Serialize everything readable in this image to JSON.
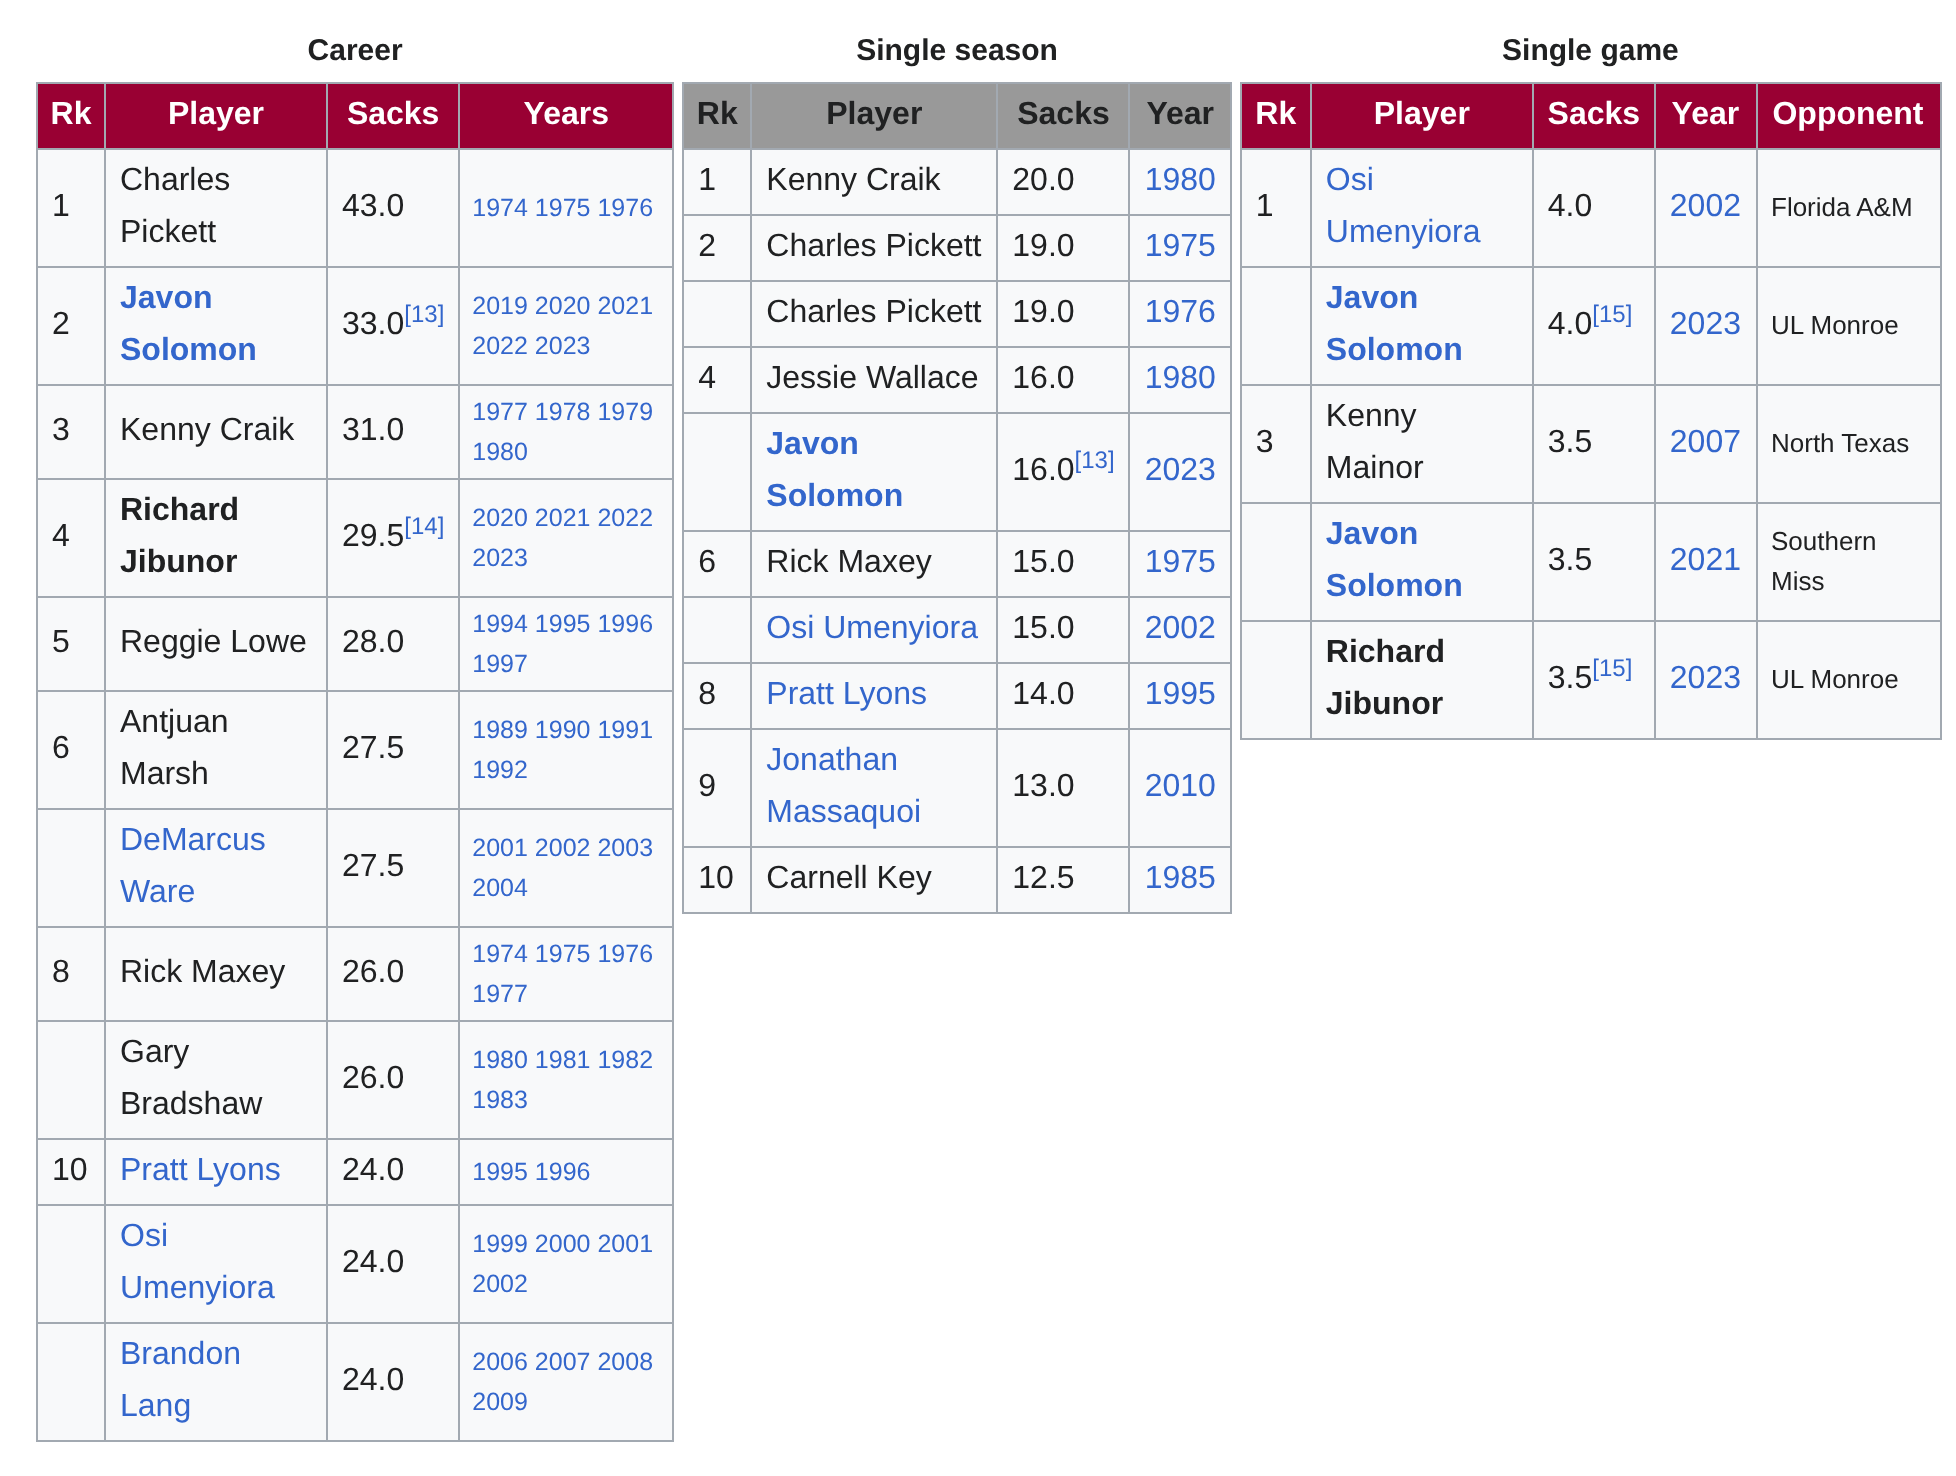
{
  "tables": [
    {
      "title": "Career",
      "color": "#990033",
      "columns": [
        {
          "label": "Rk",
          "kind": "rank"
        },
        {
          "label": "Player",
          "kind": "player"
        },
        {
          "label": "Sacks",
          "kind": "sacks"
        },
        {
          "label": "Years",
          "kind": "years"
        }
      ],
      "rows": [
        {
          "rank": "1",
          "player": "Charles Pickett",
          "link": false,
          "bold": false,
          "sacks": "43.0",
          "years": "1974 1975 1976"
        },
        {
          "rank": "2",
          "player": "Javon Solomon",
          "link": true,
          "bold": true,
          "sacks": "33.0$^{[13]}$",
          "years": "2019 2020 2021 2022 2023"
        },
        {
          "rank": "3",
          "player": "Kenny Craik",
          "link": false,
          "bold": false,
          "sacks": "31.0",
          "years": "1977 1978 1979 1980"
        },
        {
          "rank": "4",
          "player": "Richard Jibunor",
          "link": false,
          "bold": true,
          "sacks": "29.5$^{[14]}$",
          "years": "2020 2021 2022 2023"
        },
        {
          "rank": "5",
          "player": "Reggie Lowe",
          "link": false,
          "bold": false,
          "sacks": "28.0",
          "years": "1994 1995 1996 1997"
        },
        {
          "rank": "6",
          "player": "Antjuan Marsh",
          "link": false,
          "bold": false,
          "sacks": "27.5",
          "years": "1989 1990 1991 1992"
        },
        {
          "player": "DeMarcus Ware",
          "link": true,
          "bold": false,
          "sacks": "27.5",
          "years": "2001 2002 2003 2004"
        },
        {
          "rank": "8",
          "player": "Rick Maxey",
          "link": false,
          "bold": false,
          "sacks": "26.0",
          "years": "1974 1975 1976 1977"
        },
        {
          "player": "Gary Bradshaw",
          "link": false,
          "bold": false,
          "sacks": "26.0",
          "years": "1980 1981 1982 1983"
        },
        {
          "rank": "10",
          "player": "Pratt Lyons",
          "link": true,
          "bold": false,
          "sacks": "24.0",
          "years": "1995 1996"
        },
        {
          "player": "Osi Umenyiora",
          "link": true,
          "bold": false,
          "sacks": "24.0",
          "years": "1999 2000 2001 2002"
        },
        {
          "player": "Brandon Lang",
          "link": true,
          "bold": false,
          "sacks": "24.0",
          "years": "2006 2007 2008 2009"
        }
      ]
    },
    {
      "title": "Single season",
      "color": "#999999",
      "columns": [
        {
          "label": "Rk",
          "kind": "rank"
        },
        {
          "label": "Player",
          "kind": "player"
        },
        {
          "label": "Sacks",
          "kind": "sacks"
        },
        {
          "label": "Year",
          "kind": "year"
        }
      ],
      "rows": [
        {
          "rank": "1",
          "player": "Kenny Craik",
          "link": false,
          "bold": false,
          "sacks": "20.0",
          "year": "1980"
        },
        {
          "rank": "2",
          "player": "Charles Pickett",
          "link": false,
          "bold": false,
          "sacks": "19.0",
          "year": "1975"
        },
        {
          "player": "Charles Pickett",
          "link": false,
          "bold": false,
          "sacks": "19.0",
          "year": "1976"
        },
        {
          "rank": "4",
          "player": "Jessie Wallace",
          "link": false,
          "bold": false,
          "sacks": "16.0",
          "year": "1980"
        },
        {
          "player": "Javon Solomon",
          "link": true,
          "bold": true,
          "sacks": "16.0$^{[13]}$",
          "year": "2023"
        },
        {
          "rank": "6",
          "player": "Rick Maxey",
          "link": false,
          "bold": false,
          "sacks": "15.0",
          "year": "1975"
        },
        {
          "player": "Osi Umenyiora",
          "link": true,
          "bold": false,
          "sacks": "15.0",
          "year": "2002"
        },
        {
          "rank": "8",
          "player": "Pratt Lyons",
          "link": true,
          "bold": false,
          "sacks": "14.0",
          "year": "1995"
        },
        {
          "rank": "9",
          "player": "Jonathan Massaquoi",
          "link": true,
          "bold": false,
          "sacks": "13.0",
          "year": "2010"
        },
        {
          "rank": "10",
          "player": "Carnell Key",
          "link": false,
          "bold": false,
          "sacks": "12.5",
          "year": "1985"
        }
      ]
    },
    {
      "title": "Single game",
      "color": "#990033",
      "columns": [
        {
          "label": "Rk",
          "kind": "rank"
        },
        {
          "label": "Player",
          "kind": "player"
        },
        {
          "label": "Sacks",
          "kind": "sacks"
        },
        {
          "label": "Year",
          "kind": "year"
        },
        {
          "label": "Opponent",
          "kind": "opponent"
        }
      ],
      "rows": [
        {
          "rank": "1",
          "player": "Osi Umenyiora",
          "link": true,
          "bold": false,
          "sacks": "4.0",
          "year": "2002",
          "opponent": "Florida A&M"
        },
        {
          "player": "Javon Solomon",
          "link": true,
          "bold": true,
          "sacks": "4.0$^{[15]}$",
          "year": "2023",
          "opponent": "UL Monroe"
        },
        {
          "rank": "3",
          "player": "Kenny Mainor",
          "link": false,
          "bold": false,
          "sacks": "3.5",
          "year": "2007",
          "opponent": "North Texas"
        },
        {
          "player": "Javon Solomon",
          "link": true,
          "bold": true,
          "sacks": "3.5",
          "year": "2021",
          "opponent": "Southern Miss"
        },
        {
          "player": "Richard Jibunor",
          "link": false,
          "bold": true,
          "sacks": "3.5$^{[15]}$",
          "year": "2023",
          "opponent": "UL Monroe"
        }
      ]
    }
  ]
}
